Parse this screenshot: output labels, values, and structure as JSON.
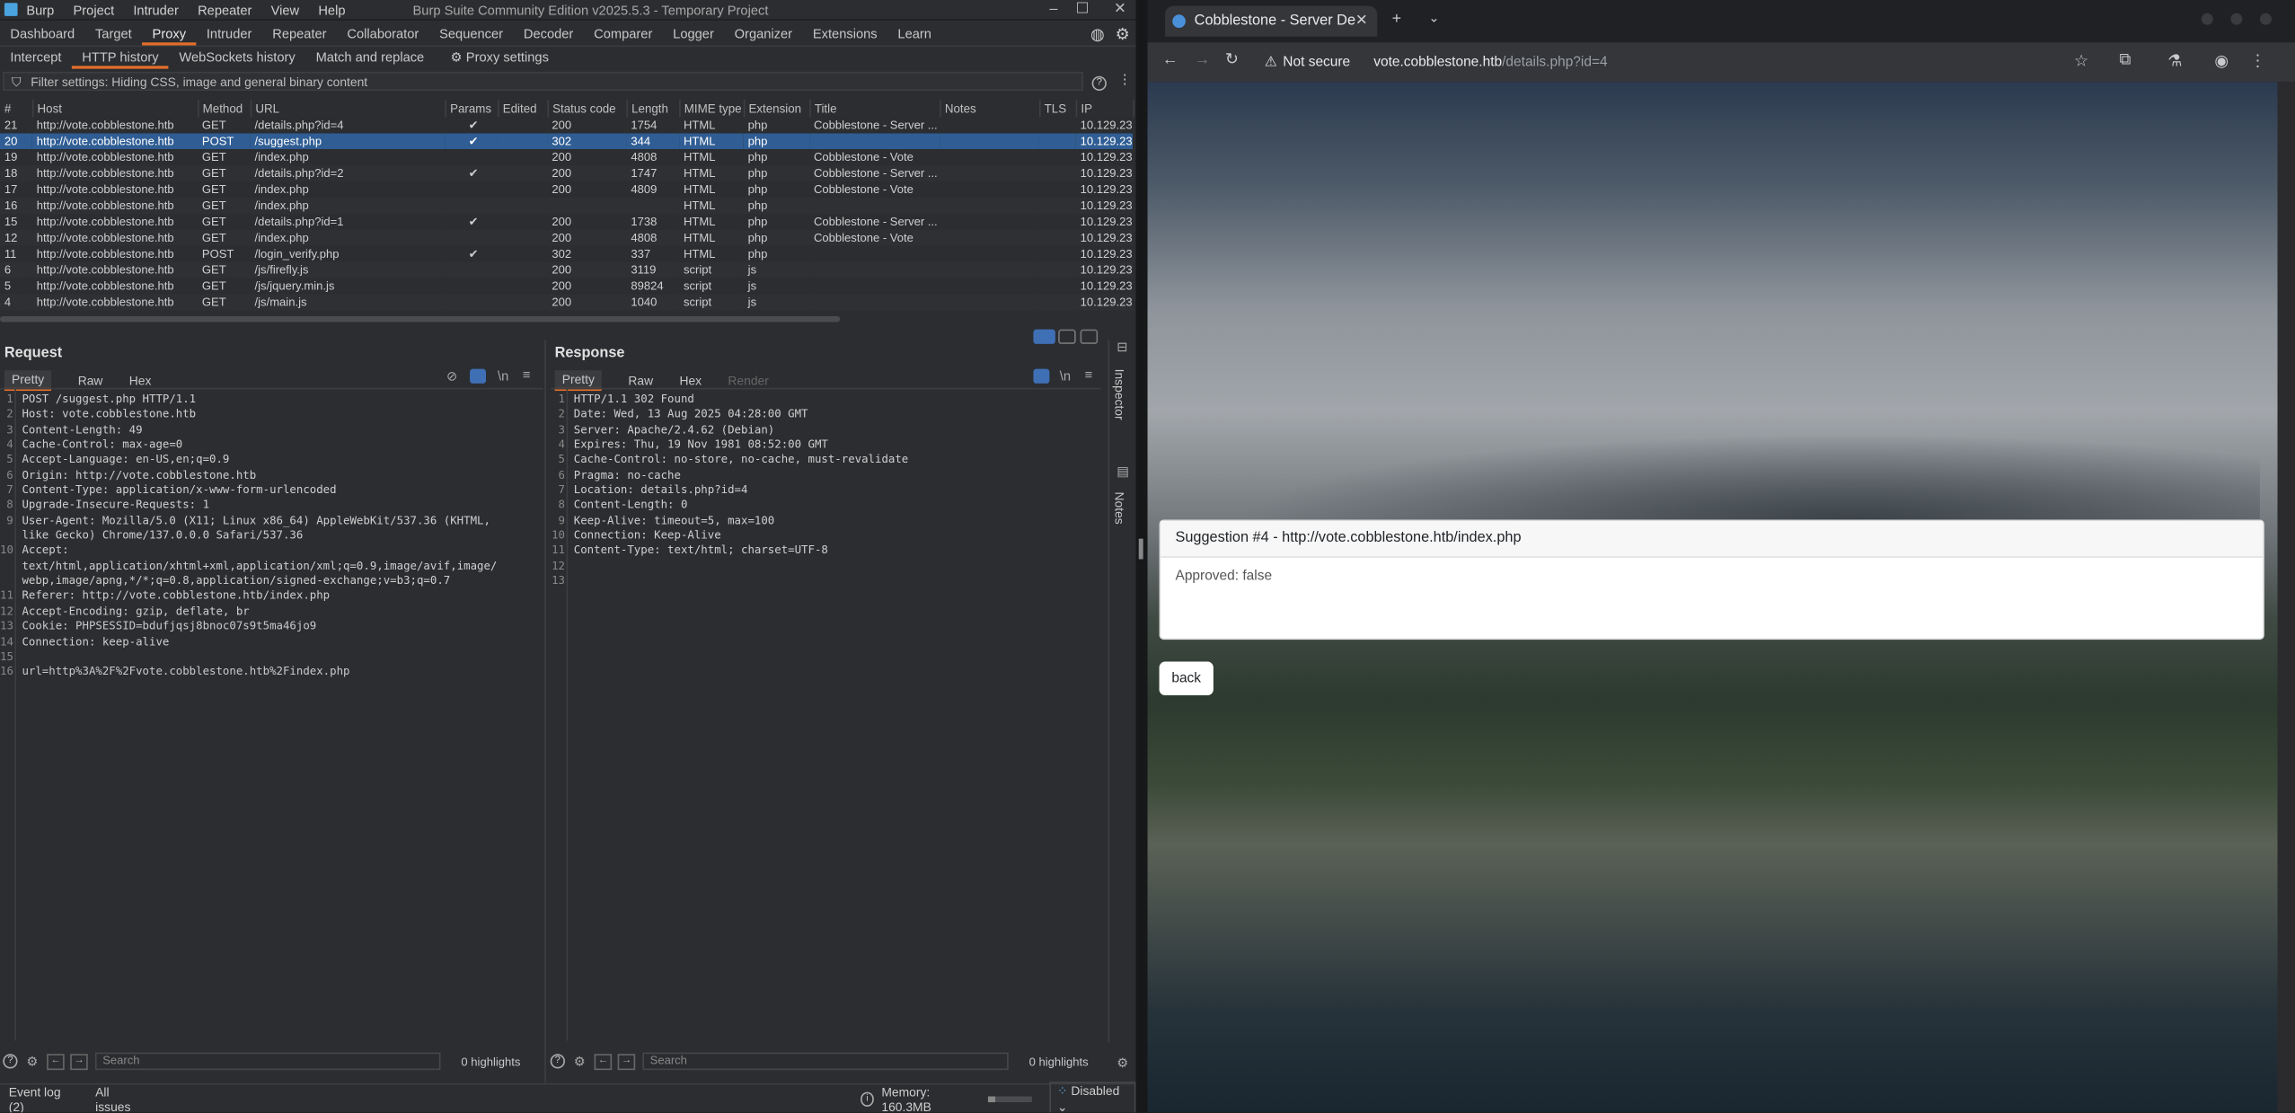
{
  "burp": {
    "menu": [
      "Burp",
      "Project",
      "Intruder",
      "Repeater",
      "View",
      "Help"
    ],
    "title": "Burp Suite Community Edition v2025.5.3 - Temporary Project",
    "main_tabs": [
      "Dashboard",
      "Target",
      "Proxy",
      "Intruder",
      "Repeater",
      "Collaborator",
      "Sequencer",
      "Decoder",
      "Comparer",
      "Logger",
      "Organizer",
      "Extensions",
      "Learn"
    ],
    "selected_main_tab": "Proxy",
    "proxy_tabs": [
      "Intercept",
      "HTTP history",
      "WebSockets history",
      "Match and replace",
      "Proxy settings"
    ],
    "selected_proxy_tab": "HTTP history",
    "filter": "Filter settings: Hiding CSS, image and general binary content",
    "columns": [
      "#",
      "Host",
      "Method",
      "URL",
      "Params",
      "Edited",
      "Status code",
      "Length",
      "MIME type",
      "Extension",
      "Title",
      "Notes",
      "TLS",
      "IP"
    ],
    "rows": [
      {
        "n": "21",
        "host": "http://vote.cobblestone.htb",
        "method": "GET",
        "url": "/details.php?id=4",
        "params": "✔",
        "status": "200",
        "length": "1754",
        "mime": "HTML",
        "ext": "php",
        "title": "Cobblestone - Server ...",
        "ip": "10.129.23"
      },
      {
        "n": "20",
        "host": "http://vote.cobblestone.htb",
        "method": "POST",
        "url": "/suggest.php",
        "params": "✔",
        "status": "302",
        "length": "344",
        "mime": "HTML",
        "ext": "php",
        "title": "",
        "ip": "10.129.23"
      },
      {
        "n": "19",
        "host": "http://vote.cobblestone.htb",
        "method": "GET",
        "url": "/index.php",
        "params": "",
        "status": "200",
        "length": "4808",
        "mime": "HTML",
        "ext": "php",
        "title": "Cobblestone - Vote",
        "ip": "10.129.23"
      },
      {
        "n": "18",
        "host": "http://vote.cobblestone.htb",
        "method": "GET",
        "url": "/details.php?id=2",
        "params": "✔",
        "status": "200",
        "length": "1747",
        "mime": "HTML",
        "ext": "php",
        "title": "Cobblestone - Server ...",
        "ip": "10.129.23"
      },
      {
        "n": "17",
        "host": "http://vote.cobblestone.htb",
        "method": "GET",
        "url": "/index.php",
        "params": "",
        "status": "200",
        "length": "4809",
        "mime": "HTML",
        "ext": "php",
        "title": "Cobblestone - Vote",
        "ip": "10.129.23"
      },
      {
        "n": "16",
        "host": "http://vote.cobblestone.htb",
        "method": "GET",
        "url": "/index.php",
        "params": "",
        "status": "",
        "length": "",
        "mime": "HTML",
        "ext": "php",
        "title": "",
        "ip": "10.129.23"
      },
      {
        "n": "15",
        "host": "http://vote.cobblestone.htb",
        "method": "GET",
        "url": "/details.php?id=1",
        "params": "✔",
        "status": "200",
        "length": "1738",
        "mime": "HTML",
        "ext": "php",
        "title": "Cobblestone - Server ...",
        "ip": "10.129.23"
      },
      {
        "n": "12",
        "host": "http://vote.cobblestone.htb",
        "method": "GET",
        "url": "/index.php",
        "params": "",
        "status": "200",
        "length": "4808",
        "mime": "HTML",
        "ext": "php",
        "title": "Cobblestone - Vote",
        "ip": "10.129.23"
      },
      {
        "n": "11",
        "host": "http://vote.cobblestone.htb",
        "method": "POST",
        "url": "/login_verify.php",
        "params": "✔",
        "status": "302",
        "length": "337",
        "mime": "HTML",
        "ext": "php",
        "title": "",
        "ip": "10.129.23"
      },
      {
        "n": "6",
        "host": "http://vote.cobblestone.htb",
        "method": "GET",
        "url": "/js/firefly.js",
        "params": "",
        "status": "200",
        "length": "3119",
        "mime": "script",
        "ext": "js",
        "title": "",
        "ip": "10.129.23"
      },
      {
        "n": "5",
        "host": "http://vote.cobblestone.htb",
        "method": "GET",
        "url": "/js/jquery.min.js",
        "params": "",
        "status": "200",
        "length": "89824",
        "mime": "script",
        "ext": "js",
        "title": "",
        "ip": "10.129.23"
      },
      {
        "n": "4",
        "host": "http://vote.cobblestone.htb",
        "method": "GET",
        "url": "/js/main.js",
        "params": "",
        "status": "200",
        "length": "1040",
        "mime": "script",
        "ext": "js",
        "title": "",
        "ip": "10.129.23"
      }
    ],
    "request": {
      "heading": "Request",
      "tabs": [
        "Pretty",
        "Raw",
        "Hex"
      ],
      "lines": [
        [
          "1",
          "POST /suggest.php HTTP/1.1"
        ],
        [
          "2",
          "Host: vote.cobblestone.htb"
        ],
        [
          "3",
          "Content-Length: 49"
        ],
        [
          "4",
          "Cache-Control: max-age=0"
        ],
        [
          "5",
          "Accept-Language: en-US,en;q=0.9"
        ],
        [
          "6",
          "Origin: http://vote.cobblestone.htb"
        ],
        [
          "7",
          "Content-Type: application/x-www-form-urlencoded"
        ],
        [
          "8",
          "Upgrade-Insecure-Requests: 1"
        ],
        [
          "9",
          "User-Agent: Mozilla/5.0 (X11; Linux x86_64) AppleWebKit/537.36 (KHTML,"
        ],
        [
          "",
          "like Gecko) Chrome/137.0.0.0 Safari/537.36"
        ],
        [
          "10",
          "Accept:"
        ],
        [
          "",
          "text/html,application/xhtml+xml,application/xml;q=0.9,image/avif,image/"
        ],
        [
          "",
          "webp,image/apng,*/*;q=0.8,application/signed-exchange;v=b3;q=0.7"
        ],
        [
          "11",
          "Referer: http://vote.cobblestone.htb/index.php"
        ],
        [
          "12",
          "Accept-Encoding: gzip, deflate, br"
        ],
        [
          "13",
          "Cookie: PHPSESSID=bdufjqsj8bnoc07s9t5ma46jo9"
        ],
        [
          "14",
          "Connection: keep-alive"
        ],
        [
          "15",
          ""
        ],
        [
          "16",
          "url=http%3A%2F%2Fvote.cobblestone.htb%2Findex.php"
        ]
      ],
      "search_placeholder": "Search",
      "highlights": "0 highlights"
    },
    "response": {
      "heading": "Response",
      "tabs": [
        "Pretty",
        "Raw",
        "Hex",
        "Render"
      ],
      "lines": [
        [
          "1",
          "HTTP/1.1 302 Found"
        ],
        [
          "2",
          "Date: Wed, 13 Aug 2025 04:28:00 GMT"
        ],
        [
          "3",
          "Server: Apache/2.4.62 (Debian)"
        ],
        [
          "4",
          "Expires: Thu, 19 Nov 1981 08:52:00 GMT"
        ],
        [
          "5",
          "Cache-Control: no-store, no-cache, must-revalidate"
        ],
        [
          "6",
          "Pragma: no-cache"
        ],
        [
          "7",
          "Location: details.php?id=4"
        ],
        [
          "8",
          "Content-Length: 0"
        ],
        [
          "9",
          "Keep-Alive: timeout=5, max=100"
        ],
        [
          "10",
          "Connection: Keep-Alive"
        ],
        [
          "11",
          "Content-Type: text/html; charset=UTF-8"
        ],
        [
          "12",
          ""
        ],
        [
          "13",
          ""
        ]
      ],
      "search_placeholder": "Search",
      "highlights": "0 highlights"
    },
    "side_tabs": [
      "Inspector",
      "Notes"
    ],
    "status": {
      "event_log": "Event log (2)",
      "all_issues": "All issues",
      "memory": "Memory: 160.3MB",
      "disabled": "Disabled"
    }
  },
  "browser": {
    "tab_title": "Cobblestone - Server De",
    "not_secure": "Not secure",
    "url_host": "vote.cobblestone.htb",
    "url_path": "/details.php?id=4",
    "card_title": "Suggestion #4 - http://vote.cobblestone.htb/index.php",
    "card_body": "Approved: false",
    "back": "back"
  }
}
